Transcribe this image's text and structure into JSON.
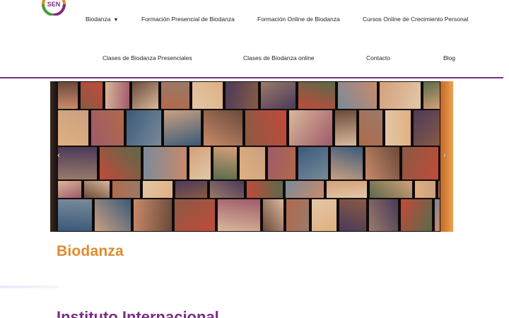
{
  "brand": {
    "logo_text": "SEN",
    "colors": {
      "orange": "#e08a2e",
      "purple": "#7b2d86",
      "green": "#4b9b3c"
    }
  },
  "nav": {
    "row1": [
      {
        "label": "Biodanza",
        "has_dropdown": true
      },
      {
        "label": "Formación Presencial de Biodanza"
      },
      {
        "label": "Formación Online de Biodanza"
      },
      {
        "label": "Cursos Online de Crecimiento Personal"
      }
    ],
    "row2": [
      {
        "label": "Clases de Biodanza Presenciales"
      },
      {
        "label": "Clases de Biodanza online"
      },
      {
        "label": "Contacto"
      },
      {
        "label": "Blog"
      }
    ],
    "dropdown_icon": "caret-down-icon"
  },
  "slider": {
    "prev_icon": "chevron-left-icon",
    "next_icon": "chevron-right-icon",
    "prev_glyph": "‹",
    "next_glyph": "›"
  },
  "main": {
    "title": "Biodanza",
    "subtitle": "Instituto Internacional"
  }
}
